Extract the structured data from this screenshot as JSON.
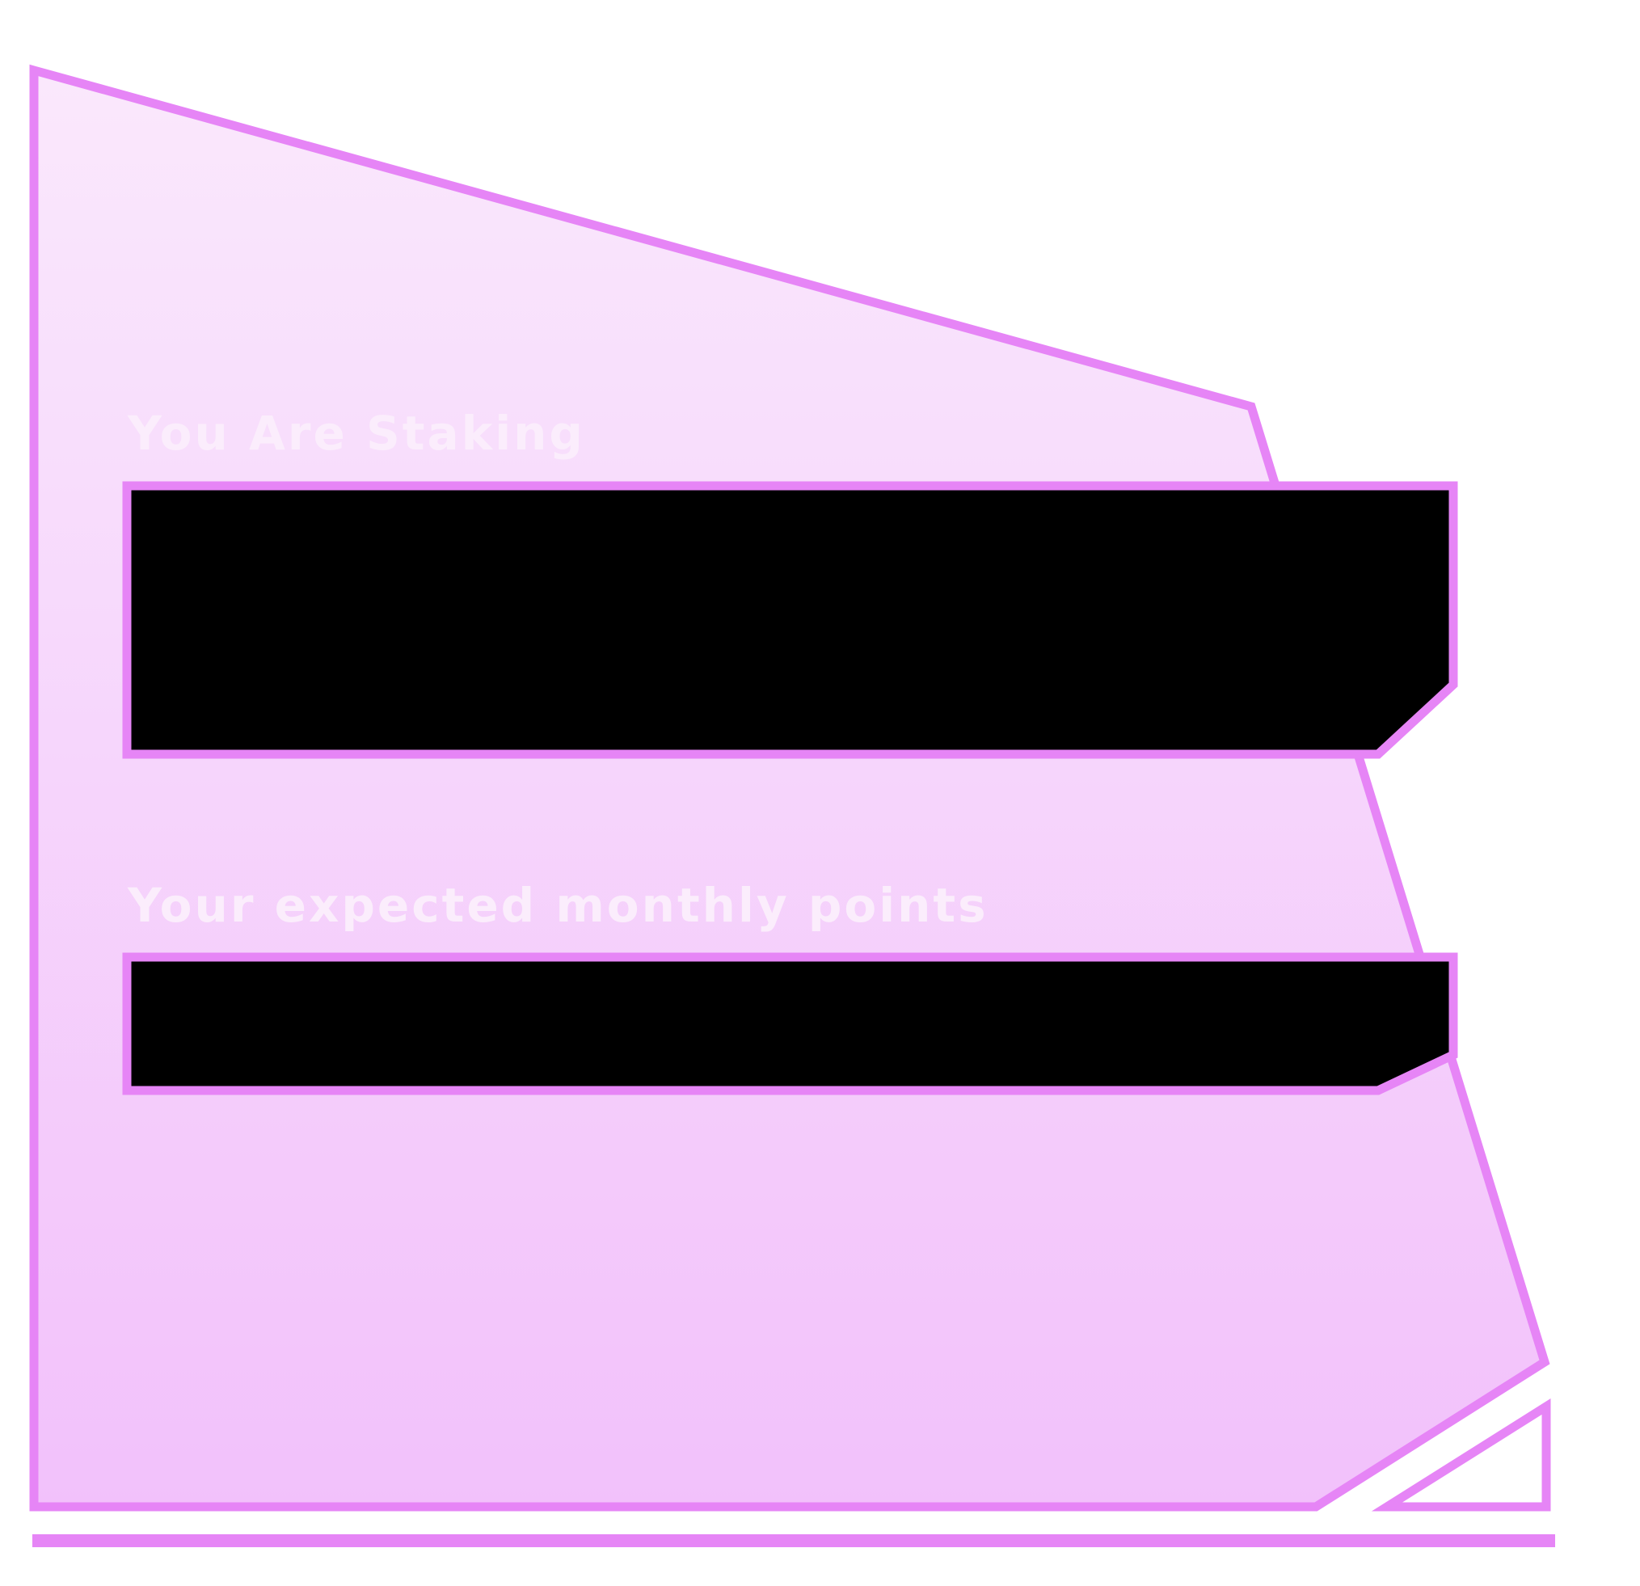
{
  "colors": {
    "border": "#e685f6",
    "panel_top": "#fae8fc",
    "panel_bottom": "#f2c1fb",
    "label_text": "#fbedfc",
    "field_fill": "#000000",
    "background": "#ffffff"
  },
  "staking": {
    "label": "You Are Staking",
    "value": ""
  },
  "points": {
    "label": "Your expected monthly points",
    "value": ""
  }
}
